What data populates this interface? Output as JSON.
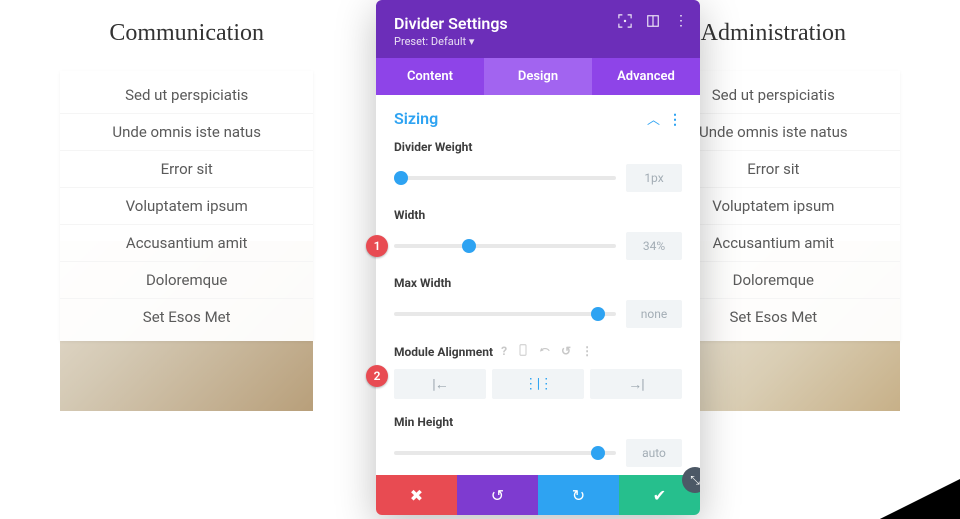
{
  "columns": [
    {
      "title": "Communication",
      "items": [
        "Sed ut perspiciatis",
        "Unde omnis iste natus",
        "Error sit",
        "Voluptatem ipsum",
        "Accusantium amit",
        "Doloremque",
        "Set Esos Met"
      ]
    },
    {
      "title": "Administration",
      "items": [
        "Sed ut perspiciatis",
        "Unde omnis iste natus",
        "Error sit",
        "Voluptatem ipsum",
        "Accusantium amit",
        "Doloremque",
        "Set Esos Met"
      ]
    }
  ],
  "panel": {
    "title": "Divider Settings",
    "preset": "Preset: Default ▾",
    "tabs": [
      "Content",
      "Design",
      "Advanced"
    ],
    "activeTab": 1,
    "section": "Sizing",
    "fields": {
      "weight": {
        "label": "Divider Weight",
        "value": "1px",
        "pos": 3
      },
      "width": {
        "label": "Width",
        "value": "34%",
        "pos": 34
      },
      "maxwidth": {
        "label": "Max Width",
        "value": "none",
        "pos": 92
      },
      "align": {
        "label": "Module Alignment",
        "active": 1
      },
      "minheight": {
        "label": "Min Height",
        "value": "auto",
        "pos": 92
      }
    }
  },
  "markers": {
    "m1": "1",
    "m2": "2"
  }
}
